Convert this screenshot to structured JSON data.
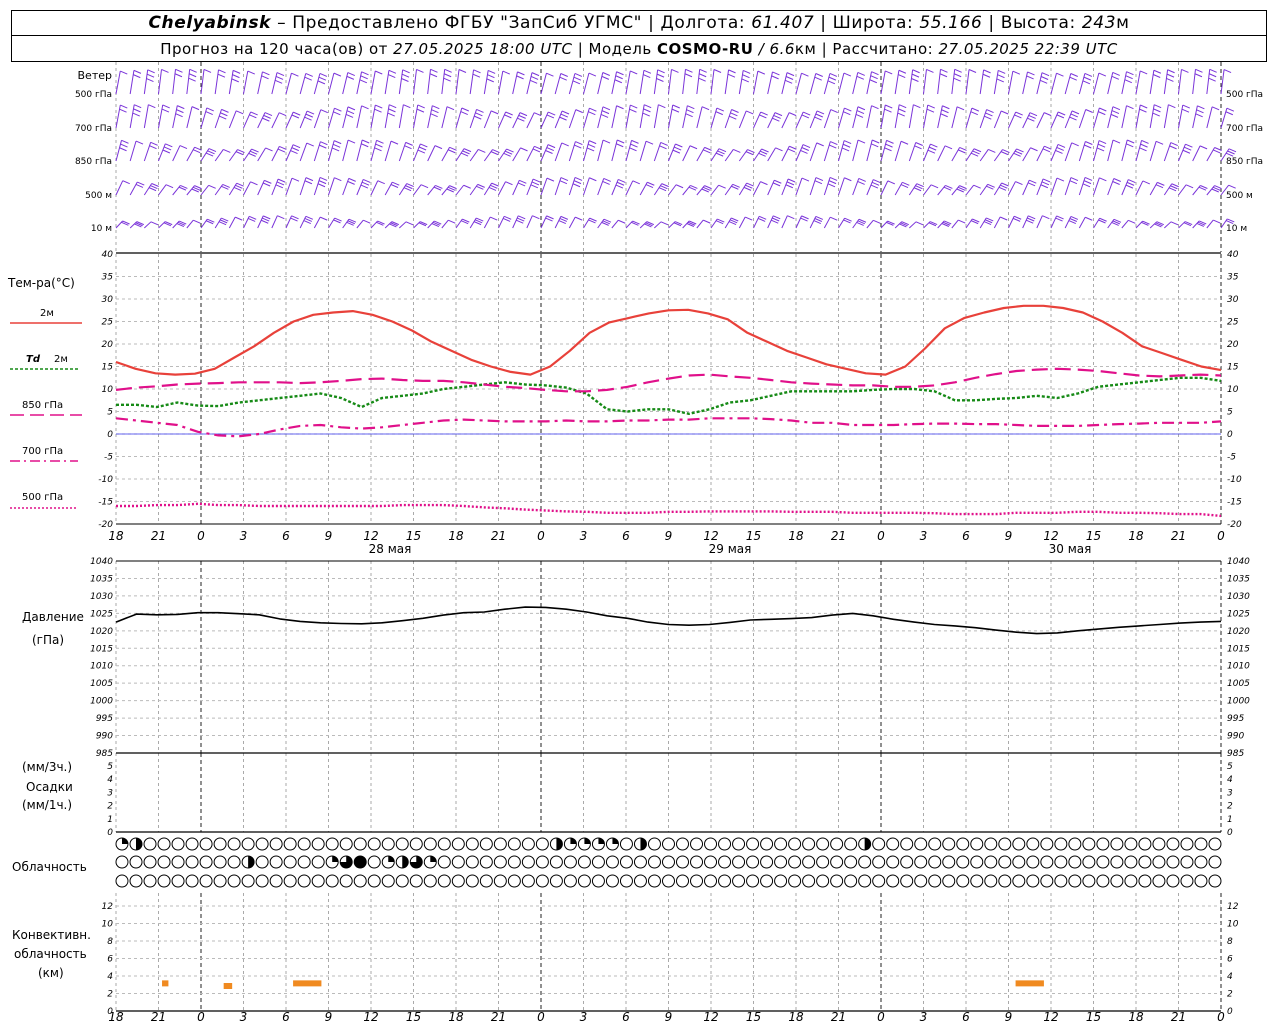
{
  "header": {
    "city": "Chelyabinsk",
    "provider": "– Предоставлено ФГБУ \"ЗапСиб УГМС\"",
    "lon_label": "Долгота:",
    "lon_value": "61.407",
    "lat_label": "Широта:",
    "lat_value": "55.166",
    "alt_label": "Высота:",
    "alt_value": "243",
    "alt_unit": "м",
    "forecast_prefix": "Прогноз на 120 часа(ов) от",
    "forecast_start": "27.05.2025 18:00 UTC",
    "model_label": "Модель",
    "model_name": "COSMO-RU",
    "model_res": "/ 6.6",
    "model_res_unit": "км",
    "calc_label": "Рассчитано:",
    "calc_value": "27.05.2025 22:39 UTC"
  },
  "colors": {
    "t2m": "#e8413a",
    "td": "#168a16",
    "t850": "#e0108a",
    "t700": "#e0108a",
    "t500": "#e0108a",
    "wind": "#7a33d9",
    "pressure": "#000000",
    "conv": "#f08a20",
    "zero_line": "#3333ee"
  },
  "time_axis": {
    "hour_ticks": [
      "18",
      "21",
      "0",
      "3",
      "6",
      "9",
      "12",
      "15",
      "18",
      "21",
      "0",
      "3",
      "6",
      "9",
      "12",
      "15",
      "18",
      "21",
      "0",
      "3",
      "6",
      "9",
      "12",
      "15",
      "18",
      "21",
      "0"
    ],
    "day_labels": [
      "28 мая",
      "29 мая",
      "30 мая"
    ]
  },
  "wind_panel": {
    "title": "Ветер",
    "levels": [
      "500 гПа",
      "700 гПа",
      "850 гПа",
      "500 м",
      "10 м"
    ]
  },
  "temp_panel": {
    "title": "Тем-ра(°C)",
    "legend": {
      "t2m": "2м",
      "td_sym": "Td",
      "td_lvl": "2м",
      "t850": "850 гПа",
      "t700": "700 гПа",
      "t500": "500 гПа"
    },
    "yticks": [
      "40",
      "35",
      "30",
      "25",
      "20",
      "15",
      "10",
      "5",
      "0",
      "-5",
      "-10",
      "-15",
      "-20"
    ]
  },
  "pressure_panel": {
    "title": "Давление",
    "unit": "(гПа)",
    "yticks": [
      "1040",
      "1035",
      "1030",
      "1025",
      "1020",
      "1015",
      "1010",
      "1005",
      "1000",
      "995",
      "990",
      "985"
    ]
  },
  "precip_panel": {
    "unit_3h": "(мм/3ч.)",
    "title": "Осадки",
    "unit_1h": "(мм/1ч.)",
    "yticks": [
      "5",
      "4",
      "3",
      "2",
      "1",
      "0"
    ]
  },
  "cloud_panel": {
    "title": "Облачность"
  },
  "conv_panel": {
    "title1": "Конвективн.",
    "title2": "облачность",
    "unit": "(км)",
    "yticks": [
      "12",
      "10",
      "8",
      "6",
      "4",
      "2",
      "0"
    ]
  },
  "chart_data": {
    "type": "line",
    "x_hours_utc": [
      18,
      19.5,
      21,
      22.5,
      0,
      1.5,
      3,
      4.5,
      6,
      7.5,
      9,
      10.5,
      12,
      13.5,
      15,
      16.5,
      18,
      19.5,
      21,
      22.5,
      0,
      1.5,
      3,
      4.5,
      6,
      7.5,
      9,
      10.5,
      12,
      13.5,
      15,
      16.5,
      18,
      19.5,
      21,
      22.5,
      0,
      1.5,
      3,
      4.5,
      6,
      7.5,
      9,
      10.5,
      12,
      13.5,
      15,
      16.5,
      18,
      19.5,
      21,
      22.5,
      0
    ],
    "series": [
      {
        "name": "Т 2м",
        "unit": "°C",
        "values": [
          16,
          14.5,
          13.5,
          13.2,
          13.4,
          14.5,
          17,
          19.5,
          22.5,
          25,
          26.5,
          27,
          27.3,
          26.5,
          25,
          23,
          20.5,
          18.5,
          16.5,
          15,
          13.8,
          13.2,
          15,
          18.5,
          22.5,
          24.8,
          25.8,
          26.8,
          27.5,
          27.6,
          26.8,
          25.5,
          22.5,
          20.5,
          18.5,
          17,
          15.5,
          14.5,
          13.5,
          13.2,
          15,
          19,
          23.5,
          25.8,
          27,
          28,
          28.5,
          28.5,
          28,
          27,
          25,
          22.5,
          19.5,
          18,
          16.5,
          15,
          14.2
        ]
      },
      {
        "name": "Td 2м",
        "unit": "°C",
        "values": [
          6.5,
          6.5,
          6,
          7,
          6.3,
          6.2,
          7,
          7.5,
          8,
          8.5,
          9,
          8,
          6,
          8,
          8.5,
          9,
          10,
          10.5,
          11,
          11.5,
          11,
          10.8,
          10.3,
          9,
          5.5,
          5,
          5.5,
          5.5,
          4.5,
          5.5,
          7,
          7.5,
          8.5,
          9.5,
          9.5,
          9.5,
          9.5,
          9.8,
          10,
          10,
          9.5,
          7.5,
          7.5,
          7.8,
          8,
          8.5,
          8,
          9,
          10.5,
          11,
          11.5,
          12,
          12.5,
          12.5,
          11.8
        ]
      },
      {
        "name": "Т 850 гПа",
        "unit": "°C",
        "values": [
          9.8,
          10.3,
          10.6,
          11,
          11.2,
          11.3,
          11.5,
          11.5,
          11.5,
          11.3,
          11.5,
          11.8,
          12.2,
          12.3,
          12,
          11.8,
          11.8,
          11.5,
          11,
          10.5,
          10.2,
          9.8,
          9.5,
          9.5,
          9.8,
          10.5,
          11.5,
          12.3,
          13,
          13.2,
          12.8,
          12.5,
          12,
          11.5,
          11.2,
          11,
          10.8,
          10.8,
          10.5,
          10.5,
          10.8,
          11.5,
          12.5,
          13.3,
          14,
          14.3,
          14.5,
          14.3,
          14,
          13.5,
          13,
          12.8,
          13,
          13.2,
          13
        ]
      },
      {
        "name": "Т 700 гПа",
        "unit": "°C",
        "values": [
          3.5,
          3,
          2.5,
          2,
          0.5,
          -0.3,
          -0.5,
          0,
          1,
          1.8,
          2,
          1.5,
          1.2,
          1.5,
          2,
          2.5,
          3,
          3.2,
          3,
          2.8,
          2.8,
          2.8,
          3,
          2.8,
          2.8,
          3,
          3,
          3.2,
          3.2,
          3.5,
          3.5,
          3.5,
          3.3,
          3,
          2.5,
          2.5,
          2,
          2,
          2,
          2.2,
          2.3,
          2.3,
          2.2,
          2.2,
          2,
          1.8,
          1.8,
          1.8,
          2,
          2.2,
          2.3,
          2.5,
          2.5,
          2.5,
          2.8
        ]
      },
      {
        "name": "Т 500 гПа",
        "unit": "°C",
        "values": [
          -16,
          -16,
          -15.8,
          -15.8,
          -15.5,
          -15.8,
          -15.8,
          -16,
          -16,
          -16,
          -16,
          -16,
          -16,
          -16,
          -15.8,
          -15.8,
          -15.8,
          -16,
          -16.3,
          -16.5,
          -16.8,
          -17,
          -17.2,
          -17.3,
          -17.5,
          -17.5,
          -17.5,
          -17.3,
          -17.3,
          -17.2,
          -17.2,
          -17.2,
          -17.2,
          -17.3,
          -17.3,
          -17.3,
          -17.5,
          -17.5,
          -17.5,
          -17.5,
          -17.6,
          -17.8,
          -17.8,
          -17.8,
          -17.5,
          -17.5,
          -17.5,
          -17.3,
          -17.3,
          -17.5,
          -17.5,
          -17.6,
          -17.8,
          -17.8,
          -18.2
        ]
      },
      {
        "name": "Давление",
        "unit": "гПа",
        "values": [
          1022.5,
          1024.8,
          1024.6,
          1024.7,
          1025.2,
          1025.2,
          1024.9,
          1024.6,
          1023.4,
          1022.7,
          1022.3,
          1022.1,
          1022,
          1022.3,
          1022.9,
          1023.6,
          1024.5,
          1025.2,
          1025.4,
          1026.2,
          1026.8,
          1026.7,
          1026.2,
          1025.4,
          1024.3,
          1023.6,
          1022.5,
          1021.8,
          1021.6,
          1021.8,
          1022.4,
          1023.1,
          1023.3,
          1023.5,
          1023.8,
          1024.5,
          1025,
          1024.3,
          1023.3,
          1022.5,
          1021.8,
          1021.4,
          1020.9,
          1020.2,
          1019.6,
          1019.2,
          1019.4,
          1020,
          1020.5,
          1021,
          1021.4,
          1021.8,
          1022.2,
          1022.5,
          1022.7
        ]
      }
    ],
    "convective_cloud_km": [
      {
        "from_hour_index": 3.25,
        "to_hour_index": 3.7,
        "base_km": 3
      },
      {
        "from_hour_index": 7.6,
        "to_hour_index": 8.2,
        "base_km": 2.7
      },
      {
        "from_hour_index": 12.5,
        "to_hour_index": 14.5,
        "base_km": 3
      },
      {
        "from_hour_index": 63.5,
        "to_hour_index": 65.5,
        "base_km": 3
      }
    ],
    "cloud_rows": {
      "high": [
        "1/4",
        "1/2",
        "0",
        "0",
        "0",
        "0",
        "0",
        "0",
        "0",
        "0",
        "0",
        "0",
        "0",
        "0",
        "0",
        "0",
        "0",
        "0",
        "0",
        "0",
        "0",
        "0",
        "0",
        "0",
        "0",
        "0",
        "0",
        "0",
        "0",
        "0",
        "0",
        "1/2",
        "1/4",
        "1/4",
        "1/4",
        "1/4",
        "0",
        "1/2",
        "0",
        "0",
        "0",
        "0",
        "0",
        "0",
        "0",
        "0",
        "0",
        "0",
        "0",
        "0",
        "0",
        "0",
        "0",
        "1/2",
        "0",
        "0",
        "0",
        "0",
        "0",
        "0",
        "0",
        "0",
        "0",
        "0",
        "0",
        "0",
        "0",
        "0",
        "0",
        "0",
        "0",
        "0",
        "0",
        "0",
        "0",
        "0",
        "0",
        "0",
        "0",
        "0",
        "0",
        "0",
        "0",
        "0",
        "0",
        "0",
        "0",
        "0",
        "0",
        "0",
        "1/4",
        "3/4",
        "1/2",
        "0",
        "0",
        "0",
        "0",
        "0",
        "1/4",
        "1/2",
        "3/4",
        "1/2",
        "1/4",
        "0",
        "0",
        "0",
        "0",
        "0",
        "0",
        "0",
        "0",
        "0",
        "0",
        "0",
        "0",
        "1/4",
        "1/2",
        "0",
        "0",
        "0",
        "0",
        "0",
        "1/2",
        "3/4",
        "1/2",
        "3/4",
        "1/2",
        "3/4",
        "1",
        "1",
        "1/2",
        "1"
      ],
      "mid": [
        "0",
        "0",
        "0",
        "0",
        "0",
        "0",
        "0",
        "0",
        "0",
        "1/2",
        "0",
        "0",
        "0",
        "0",
        "0",
        "1/4",
        "3/4",
        "1",
        "0",
        "1/4",
        "1/2",
        "3/4",
        "1/4",
        "0",
        "0",
        "0",
        "0",
        "0",
        "0",
        "0",
        "0",
        "0",
        "0",
        "0",
        "0",
        "0",
        "0",
        "0",
        "0",
        "0",
        "0",
        "0",
        "0",
        "0",
        "0",
        "0",
        "0",
        "0",
        "0",
        "0",
        "0",
        "0",
        "0",
        "0",
        "0",
        "0",
        "0",
        "0",
        "0",
        "0",
        "0",
        "0",
        "0",
        "0",
        "0",
        "0",
        "0",
        "0",
        "0",
        "0",
        "0",
        "0",
        "0",
        "0",
        "0",
        "0",
        "0",
        "0",
        "0",
        "0",
        "0",
        "0",
        "0",
        "0",
        "0",
        "0",
        "0",
        "0",
        "0",
        "0",
        "0",
        "0",
        "0",
        "0",
        "0",
        "0",
        "0",
        "0",
        "0",
        "0",
        "0",
        "0",
        "0",
        "0",
        "0",
        "0",
        "0",
        "0",
        "0",
        "0",
        "0",
        "0",
        "0",
        "0",
        "0",
        "0",
        "0",
        "0",
        "0",
        "0",
        "0",
        "0",
        "0",
        "0",
        "0",
        "0",
        "0",
        "0",
        "0",
        "0"
      ]
    },
    "temp_ylim": [
      -20,
      40
    ],
    "pressure_ylim": [
      985,
      1040
    ],
    "precip_ylim": [
      0,
      5
    ],
    "conv_ylim": [
      0,
      12
    ]
  }
}
